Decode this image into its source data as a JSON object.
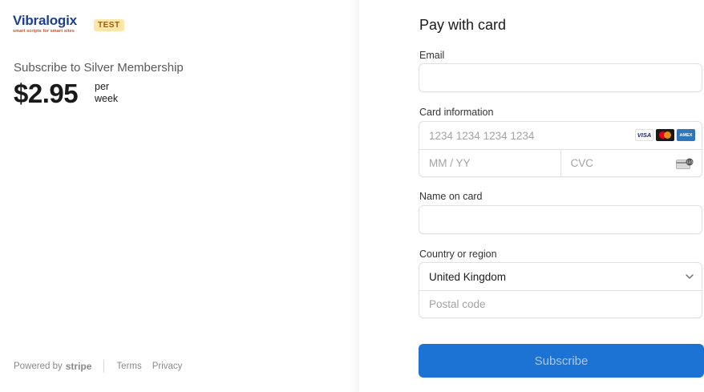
{
  "brand": {
    "name": "Vibralogix",
    "tagline": "smart scripts for smart sites",
    "badge": "TEST"
  },
  "product": {
    "title": "Subscribe to Silver Membership",
    "price": "$2.95",
    "interval_line1": "per",
    "interval_line2": "week"
  },
  "footer": {
    "powered_by": "Powered by",
    "stripe": "stripe",
    "terms": "Terms",
    "privacy": "Privacy"
  },
  "form": {
    "title": "Pay with card",
    "email_label": "Email",
    "email_value": "",
    "card_label": "Card information",
    "card_number_placeholder": "1234 1234 1234 1234",
    "expiry_placeholder": "MM / YY",
    "cvc_placeholder": "CVC",
    "card_brands": [
      "VISA",
      "mastercard",
      "AMEX"
    ],
    "name_label": "Name on card",
    "name_value": "",
    "country_label": "Country or region",
    "country_selected": "United Kingdom",
    "postal_placeholder": "Postal code",
    "submit_label": "Subscribe"
  },
  "colors": {
    "brand_blue": "#1d3f8f",
    "test_badge_bg": "#fde6a8",
    "test_badge_text": "#a35a00",
    "button_bg": "#1c73d3",
    "button_text": "#a8c8ef"
  }
}
